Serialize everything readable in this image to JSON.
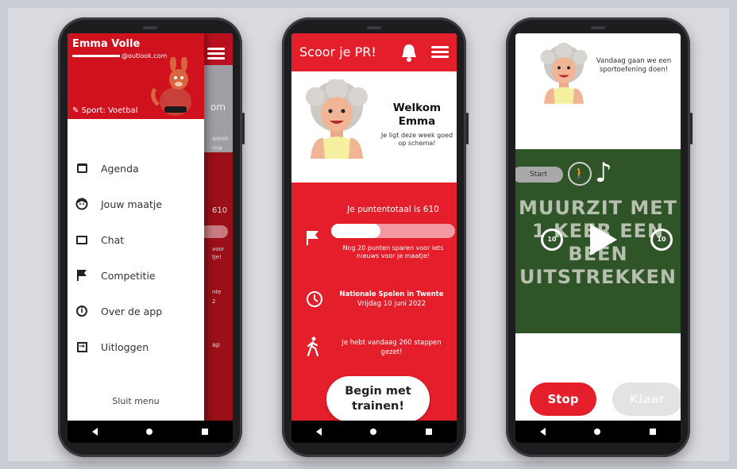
{
  "drawer_screen": {
    "user_name": "Emma Volle",
    "email_suffix": "@outlook.com",
    "sport": "Sport: Voetbal",
    "menu": [
      {
        "icon": "calendar-icon",
        "label": "Agenda"
      },
      {
        "icon": "buddy-face-icon",
        "label": "Jouw maatje"
      },
      {
        "icon": "chat-icon",
        "label": "Chat"
      },
      {
        "icon": "flag-icon",
        "label": "Competitie"
      },
      {
        "icon": "info-icon",
        "label": "Over de app"
      },
      {
        "icon": "logout-icon",
        "label": "Uitloggen"
      }
    ],
    "close_menu": "Sluit menu",
    "background_fragments": [
      "om",
      "week",
      "ma",
      "610",
      "voor",
      "tje!",
      "nte",
      "2",
      "ap"
    ]
  },
  "home_screen": {
    "title": "Scoor je PR!",
    "welcome": "Welkom Emma",
    "schedule_note": "Je ligt deze week goed op schema!",
    "points_total": "Je puntentotaal is 610",
    "points_progress": 0.4,
    "points_hint": "Nog 20 punten sparen voor iets nieuws voor je maatje!",
    "event_title": "Nationale Spelen in Twente",
    "event_date": "Vrijdag 10 juni 2022",
    "steps_text": "Je hebt vandaag 260 stappen gezet!",
    "begin_button": "Begin met trainen!"
  },
  "exercise_screen": {
    "speech": "Vandaag gaan we een sportoefening doen!",
    "start_label": "Start",
    "video_text": "MUURZIT MET 1 KEER EEN BEEN UITSTREKKEN",
    "rewind_label": "10",
    "forward_label": "10",
    "stop_button": "Stop",
    "done_button": "Klaar"
  },
  "colors": {
    "primary_red": "#e41e2b",
    "dark_red": "#b8101e",
    "video_green": "#2f5428"
  }
}
